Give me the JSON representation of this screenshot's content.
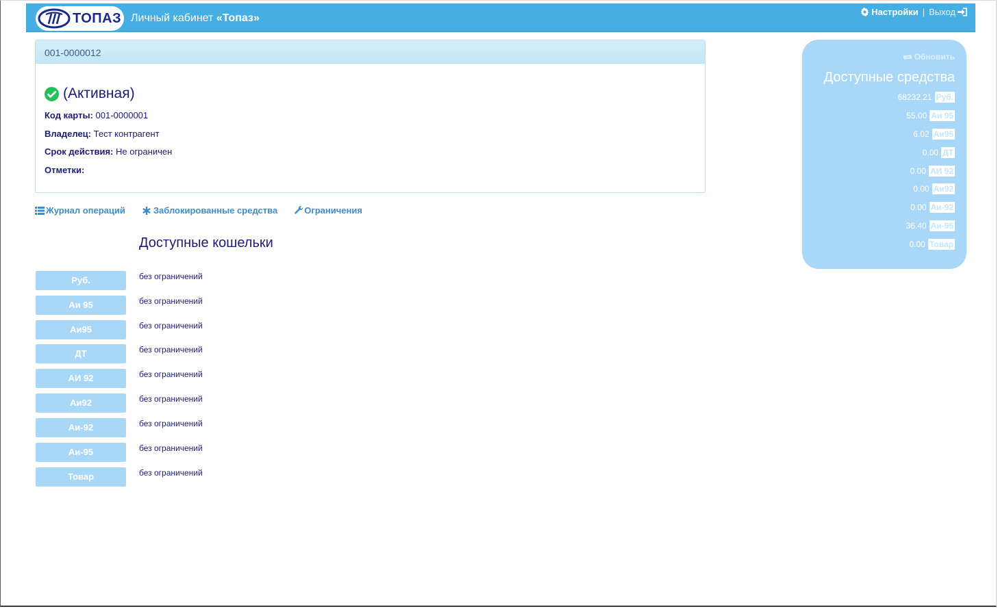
{
  "header": {
    "logo_text": "ТОПАЗ",
    "title_prefix": "Личный кабинет ",
    "title_brand": "«Топаз»",
    "settings_label": "Настройки",
    "separator": "|",
    "logout_label": "Выход"
  },
  "card": {
    "heading": "001-0000012",
    "status": "(Активная)",
    "fields": [
      {
        "key": "Код карты:",
        "value": "001-0000001"
      },
      {
        "key": "Владелец:",
        "value": "Тест контрагент"
      },
      {
        "key": "Срок действия:",
        "value": "Не ограничен"
      },
      {
        "key": "Отметки:",
        "value": ""
      }
    ]
  },
  "tabs": [
    {
      "label": "Журнал операций",
      "icon": "list-icon"
    },
    {
      "label": "Заблокированные средства",
      "icon": "asterisk-icon"
    },
    {
      "label": "Ограничения",
      "icon": "wrench-icon"
    }
  ],
  "wallets": {
    "title": "Доступные кошельки",
    "items": [
      {
        "name": "Руб.",
        "limit": "без ограничений"
      },
      {
        "name": "Аи 95",
        "limit": "без ограничений"
      },
      {
        "name": "Аи95",
        "limit": "без ограничений"
      },
      {
        "name": "ДТ",
        "limit": "без ограничений"
      },
      {
        "name": "АИ 92",
        "limit": "без ограничений"
      },
      {
        "name": "Аи92",
        "limit": "без ограничений"
      },
      {
        "name": "Аи-92",
        "limit": "без ограничений"
      },
      {
        "name": "Аи-95",
        "limit": "без ограничений"
      },
      {
        "name": "Товар",
        "limit": "без ограничений"
      }
    ]
  },
  "funds": {
    "refresh_label": "Обновить",
    "title": "Доступные средства",
    "items": [
      {
        "amount": "68232.21",
        "unit": "Руб."
      },
      {
        "amount": "55.00",
        "unit": "Аи 95"
      },
      {
        "amount": "6.02",
        "unit": "Аи95"
      },
      {
        "amount": "0.00",
        "unit": "ДТ"
      },
      {
        "amount": "0.00",
        "unit": "АИ 92"
      },
      {
        "amount": "0.00",
        "unit": "Аи92"
      },
      {
        "amount": "0.00",
        "unit": "Аи-92"
      },
      {
        "amount": "36.40",
        "unit": "Аи-95"
      },
      {
        "amount": "0.00",
        "unit": "Товар"
      }
    ]
  },
  "colors": {
    "navbar": "#45aee3",
    "accent_light": "#a9d7f7",
    "text_dark": "#1b1b7a",
    "link": "#3a8ed0",
    "status_ok": "#1fc25a"
  }
}
